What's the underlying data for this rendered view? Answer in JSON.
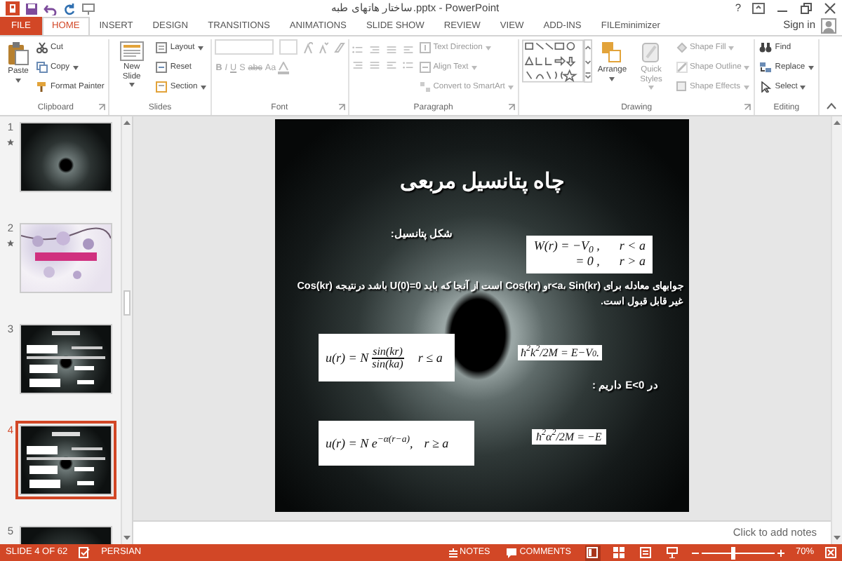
{
  "title_bar": {
    "title": "ساختار هاتهای طبه.pptx - PowerPoint",
    "help": "?"
  },
  "ribbon_tabs": [
    {
      "label": "FILE",
      "kind": "file",
      "selected": false
    },
    {
      "label": "HOME",
      "kind": "tab",
      "selected": true
    },
    {
      "label": "INSERT",
      "kind": "tab",
      "selected": false
    },
    {
      "label": "DESIGN",
      "kind": "tab",
      "selected": false
    },
    {
      "label": "TRANSITIONS",
      "kind": "tab",
      "selected": false
    },
    {
      "label": "ANIMATIONS",
      "kind": "tab",
      "selected": false
    },
    {
      "label": "SLIDE SHOW",
      "kind": "tab",
      "selected": false
    },
    {
      "label": "REVIEW",
      "kind": "tab",
      "selected": false
    },
    {
      "label": "VIEW",
      "kind": "tab",
      "selected": false
    },
    {
      "label": "ADD-INS",
      "kind": "tab",
      "selected": false
    },
    {
      "label": "FILEminimizer",
      "kind": "tab",
      "selected": false
    }
  ],
  "account": {
    "label": "Sign in"
  },
  "ribbon_groups": [
    {
      "kind": "clipboard",
      "label": "Clipboard",
      "launcher": true,
      "commands": [
        {
          "label": "Paste",
          "kind": "large",
          "dropdown": true,
          "disabled": false
        },
        {
          "label": "Cut",
          "kind": "small",
          "dropdown": false,
          "disabled": false
        },
        {
          "label": "Copy",
          "kind": "small",
          "dropdown": true,
          "disabled": false
        },
        {
          "label": "Format Painter",
          "kind": "small",
          "dropdown": false,
          "disabled": false
        }
      ]
    },
    {
      "kind": "slides",
      "label": "Slides",
      "launcher": false,
      "commands": [
        {
          "label": "New Slide",
          "kind": "large",
          "dropdown": true,
          "disabled": false
        },
        {
          "label": "Layout",
          "kind": "small",
          "dropdown": true,
          "disabled": false
        },
        {
          "label": "Reset",
          "kind": "small",
          "dropdown": false,
          "disabled": false
        },
        {
          "label": "Section",
          "kind": "small",
          "dropdown": true,
          "disabled": false
        }
      ]
    },
    {
      "kind": "font",
      "label": "Font",
      "launcher": true,
      "disabled": true,
      "format_buttons": [
        "B",
        "I",
        "U",
        "S",
        "abc",
        "Aa"
      ]
    },
    {
      "kind": "paragraph",
      "label": "Paragraph",
      "launcher": true,
      "commands": [
        {
          "label": "Text Direction",
          "kind": "small",
          "dropdown": true,
          "disabled": true
        },
        {
          "label": "Align Text",
          "kind": "small",
          "dropdown": true,
          "disabled": true
        },
        {
          "label": "Convert to SmartArt",
          "kind": "small",
          "dropdown": true,
          "disabled": true
        }
      ]
    },
    {
      "kind": "drawing",
      "label": "Drawing",
      "launcher": true,
      "commands": [
        {
          "label": "Arrange",
          "kind": "large",
          "dropdown": true,
          "disabled": false
        },
        {
          "label": "Quick Styles",
          "kind": "large",
          "dropdown": true,
          "disabled": true
        },
        {
          "label": "Shape Fill",
          "kind": "small",
          "dropdown": true,
          "disabled": true
        },
        {
          "label": "Shape Outline",
          "kind": "small",
          "dropdown": true,
          "disabled": true
        },
        {
          "label": "Shape Effects",
          "kind": "small",
          "dropdown": true,
          "disabled": true
        }
      ]
    },
    {
      "kind": "editing",
      "label": "Editing",
      "launcher": false,
      "commands": [
        {
          "label": "Find",
          "kind": "small",
          "dropdown": false,
          "disabled": false
        },
        {
          "label": "Replace",
          "kind": "small",
          "dropdown": true,
          "disabled": false
        },
        {
          "label": "Select",
          "kind": "small",
          "dropdown": true,
          "disabled": false
        }
      ]
    }
  ],
  "thumbnails": [
    {
      "number": "1",
      "kind": "dark",
      "animated": true,
      "selected": false
    },
    {
      "number": "2",
      "kind": "flowers",
      "animated": true,
      "selected": false
    },
    {
      "number": "3",
      "kind": "dark_text",
      "animated": false,
      "selected": false
    },
    {
      "number": "4",
      "kind": "dark_text",
      "animated": false,
      "selected": true
    },
    {
      "number": "5",
      "kind": "dark",
      "animated": false,
      "selected": false
    }
  ],
  "slide": {
    "elements": [
      {
        "kind": "title",
        "text": "چاه پتانسیل مربعی"
      },
      {
        "kind": "formula_cases",
        "rows": [
          {
            "expr": "W(r) = −V$_{0}$ ,",
            "condition": "r < a"
          },
          {
            "expr": "= 0 ,",
            "condition": "r > a"
          }
        ]
      },
      {
        "kind": "text",
        "text": "شکل پتانسیل:"
      },
      {
        "kind": "paragraph",
        "text": "جوابهای معادله برای r<a، Sin(kr)و Cos(kr) است از آنجا که باید U(0)=0 باشد درنتیجه Cos(kr) غیر قابل قبول است."
      },
      {
        "kind": "formula_fraction",
        "lhs": "u(r) = N",
        "numerator": "sin(kr)",
        "denominator": "sin(ka)",
        "condition": "r ≤ a"
      },
      {
        "kind": "formula",
        "text": "ħ$^{2}$k$^{2}$/2M = E−V$_{0}$."
      },
      {
        "kind": "text",
        "text": "در E<0 داریم :"
      },
      {
        "kind": "formula_condition",
        "expr": "u(r) = N e$^{−α(r−a)}$,",
        "condition": "r ≥ a"
      },
      {
        "kind": "formula",
        "text": "ħ$^{2}$α$^{2}$/2M = −E"
      }
    ]
  },
  "notes": {
    "placeholder": "Click to add notes"
  },
  "status_bar": {
    "slide_info": "SLIDE 4 OF 62",
    "language": "PERSIAN",
    "notes": "NOTES",
    "comments": "COMMENTS",
    "views": [
      {
        "selected": true
      },
      {
        "selected": false
      },
      {
        "selected": false
      },
      {
        "selected": false
      }
    ],
    "zoom": {
      "level": 0.42,
      "reading": "70%"
    }
  }
}
